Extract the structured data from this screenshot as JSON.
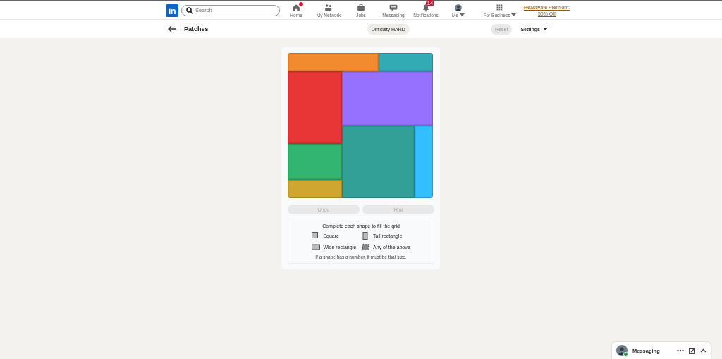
{
  "nav": {
    "logo": "in",
    "search": {
      "placeholder": "Search"
    },
    "items": [
      {
        "label": "Home",
        "dot": true
      },
      {
        "label": "My Network",
        "dot": false
      },
      {
        "label": "Jobs",
        "dot": false
      },
      {
        "label": "Messaging",
        "dot": false
      },
      {
        "label": "Notifications",
        "badge": "14",
        "dot": false
      },
      {
        "label": "Me",
        "dot": false
      }
    ],
    "business": "For Business",
    "premium": [
      "Reactivate Premium:",
      "50% Off"
    ]
  },
  "header": {
    "title": "Patches",
    "difficulty": "Difficulty HARD",
    "reset": {
      "label": "Reset",
      "disabled": true
    },
    "settings": "Settings"
  },
  "grid": {
    "patches": [
      {
        "color": "#f28a30"
      },
      {
        "color": "#33abb5"
      },
      {
        "color": "#e83535"
      },
      {
        "color": "#9670ff"
      },
      {
        "color": "#32b570"
      },
      {
        "color": "#32a096"
      },
      {
        "color": "#33bfff"
      },
      {
        "color": "#cfa630"
      }
    ]
  },
  "buttons": [
    {
      "label": "Undo",
      "disabled": true
    },
    {
      "label": "Hint",
      "disabled": true
    }
  ],
  "legend": {
    "title": "Complete each shape to fill the grid",
    "items": [
      {
        "kind": "square",
        "label": "Square"
      },
      {
        "kind": "tall",
        "label": "Tall rectangle"
      },
      {
        "kind": "wide",
        "label": "Wide rectangle"
      },
      {
        "kind": "any",
        "label": "Any of the above"
      }
    ],
    "note": "If a shape has a number, it must be that size."
  },
  "messaging": {
    "label": "Messaging"
  }
}
